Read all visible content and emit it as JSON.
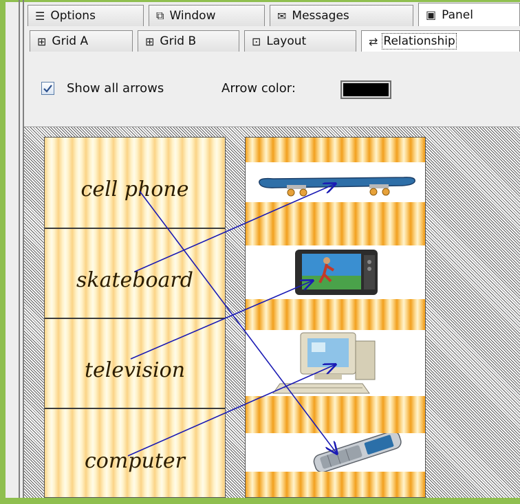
{
  "top_tabs": [
    {
      "label": "Options",
      "icon": "options-icon",
      "selected": false
    },
    {
      "label": "Window",
      "icon": "window-icon",
      "selected": false
    },
    {
      "label": "Messages",
      "icon": "messages-icon",
      "selected": false
    },
    {
      "label": "Panel",
      "icon": "panel-icon",
      "selected": true
    }
  ],
  "sub_tabs": [
    {
      "label": "Grid A",
      "icon": "grid-icon",
      "selected": false
    },
    {
      "label": "Grid B",
      "icon": "grid-icon",
      "selected": false
    },
    {
      "label": "Layout",
      "icon": "layout-icon",
      "selected": false
    },
    {
      "label": "Relationship",
      "icon": "swap-arrows-icon",
      "selected": true
    }
  ],
  "controls": {
    "show_all_arrows_label": "Show all arrows",
    "show_all_arrows_checked": true,
    "arrow_color_label": "Arrow color:",
    "arrow_color": "#000000"
  },
  "words": [
    "cell phone",
    "skateboard",
    "television",
    "computer"
  ],
  "pictures": [
    "skateboard-image",
    "television-image",
    "computer-image",
    "cell-phone-image"
  ],
  "connections": [
    {
      "from": "cell phone",
      "to": "cell-phone-image"
    },
    {
      "from": "skateboard",
      "to": "skateboard-image"
    },
    {
      "from": "television",
      "to": "television-image"
    },
    {
      "from": "computer",
      "to": "computer-image"
    }
  ],
  "colors": {
    "arrow": "#1a1ab4",
    "accent_green": "#8fbf4f",
    "stripe_dark": "#f2a01e",
    "stripe_light": "#fff3cc"
  }
}
